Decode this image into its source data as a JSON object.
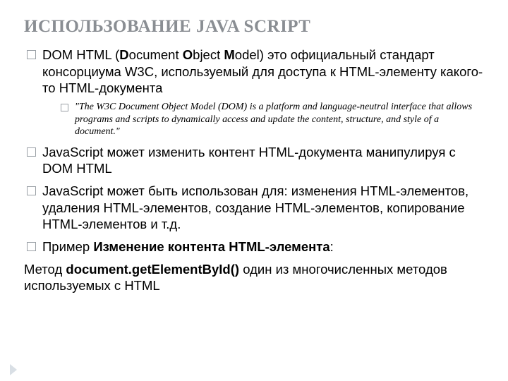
{
  "title": "ИСПОЛЬЗОВАНИЕ JAVA SCRIPT",
  "bullets": {
    "b1_before": "DOM HTML (",
    "b1_d": "D",
    "b1_doc": "ocument ",
    "b1_o": "O",
    "b1_obj": "bject ",
    "b1_m": "M",
    "b1_after": "odel) это официальный стандарт консорциума W3C, используемый для доступа к HTML-элементу какого-то HTML-документа",
    "quote": "\"The W3C Document Object Model (DOM) is a platform and language-neutral interface that allows programs and scripts to dynamically access and update the content, structure, and style of a document.\"",
    "b2": "JavaScript может изменить контент HTML-документа манипулируя c DOM HTML",
    "b3": "JavaScript может быть использован для: изменения HTML-элементов, удаления HTML-элементов, создание HTML-элементов, копирование HTML-элементов и т.д.",
    "b4_before": "Пример ",
    "b4_bold": "Изменение контента HTML-элемента",
    "b4_after": ":",
    "method_pre": "Метод ",
    "method_bold": "document.getElementById()",
    "method_after": " один из многочисленных методов используемых с HTML"
  }
}
